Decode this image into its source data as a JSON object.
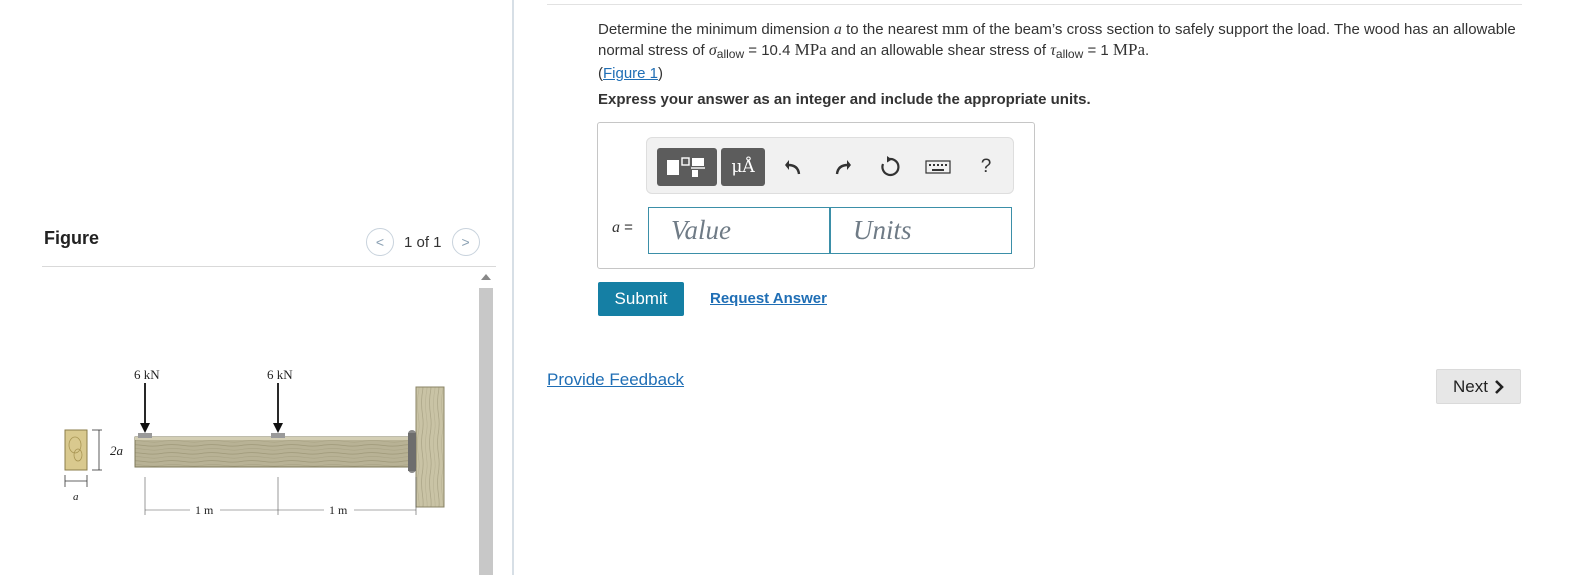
{
  "figure": {
    "title": "Figure",
    "counter": "1 of 1",
    "prev_glyph": "<",
    "next_glyph": ">",
    "labels": {
      "load_left": "6 kN",
      "load_right": "6 kN",
      "cs_height": "2a",
      "cs_width": "a",
      "span_left": "1 m",
      "span_right": "1 m"
    }
  },
  "question": {
    "part1": "Determine the minimum dimension ",
    "var_a": "a",
    "part2": " to the nearest ",
    "unit_mm": "mm",
    "part3": " of the beam’s cross section to safely support the load. The wood has an allowable normal stress of ",
    "sigma": "σ",
    "sigma_sub": "allow",
    "part4": " = 10.4 ",
    "unit_mpa_1": "MPa",
    "part5": " and an allowable shear stress of ",
    "tau": "τ",
    "tau_sub": "allow",
    "part6": " = 1 ",
    "unit_mpa_2": "MPa",
    "part7": ".",
    "figure_link_open": "(",
    "figure_link": "Figure 1",
    "figure_link_close": ")"
  },
  "instruction": "Express your answer as an integer and include the appropriate units.",
  "toolbar": {
    "units_symbol": "μÅ",
    "help": "?"
  },
  "answer": {
    "var_label": "a",
    "equals": " =",
    "value_placeholder": "Value",
    "units_placeholder": "Units"
  },
  "actions": {
    "submit": "Submit",
    "request_answer": "Request Answer",
    "feedback": "Provide Feedback",
    "next": "Next"
  },
  "colors": {
    "accent": "#157fa4",
    "link": "#1f6eb5",
    "input_border": "#3b8fa8",
    "toolbar_button": "#5c5c5c",
    "wood": "#b8b295"
  }
}
